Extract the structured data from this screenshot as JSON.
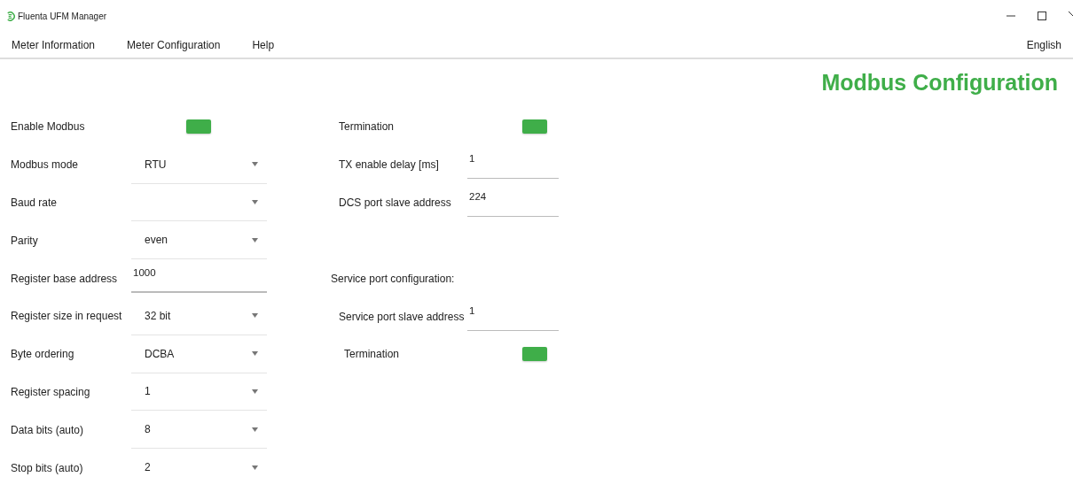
{
  "window": {
    "title": "Fluenta UFM Manager"
  },
  "menu": [
    {
      "label": "Meter Information"
    },
    {
      "label": "Meter Configuration"
    },
    {
      "label": "Help"
    }
  ],
  "language": "English",
  "page_title": "Modbus Configuration",
  "left_fields": [
    {
      "kind": "toggle",
      "label": "Enable Modbus",
      "on": true
    },
    {
      "kind": "select",
      "label": "Modbus mode",
      "value": "RTU"
    },
    {
      "kind": "select",
      "label": "Baud rate"
    },
    {
      "kind": "select",
      "label": "Parity",
      "value": "even"
    },
    {
      "kind": "input",
      "label": "Register base address",
      "value": "1000"
    },
    {
      "kind": "select",
      "label": "Register size in request",
      "value": "32 bit"
    },
    {
      "kind": "select",
      "label": "Byte ordering",
      "value": "DCBA"
    },
    {
      "kind": "select",
      "label": "Register spacing",
      "value": "1"
    },
    {
      "kind": "select",
      "label": "Data bits (auto)",
      "value": "8"
    },
    {
      "kind": "select",
      "label": "Stop bits (auto)",
      "value": "2"
    }
  ],
  "right_fields": [
    {
      "kind": "toggle",
      "label": "Termination",
      "on": true
    },
    {
      "kind": "input",
      "label": "TX enable delay [ms]",
      "value": "1"
    },
    {
      "kind": "input",
      "label": "DCS port slave address",
      "value": "224"
    }
  ],
  "service_port": {
    "title": "Service port configuration:",
    "fields": [
      {
        "kind": "input",
        "label": "Service port slave address",
        "value": "1"
      },
      {
        "kind": "toggle",
        "label": "Termination",
        "on": true
      }
    ]
  }
}
